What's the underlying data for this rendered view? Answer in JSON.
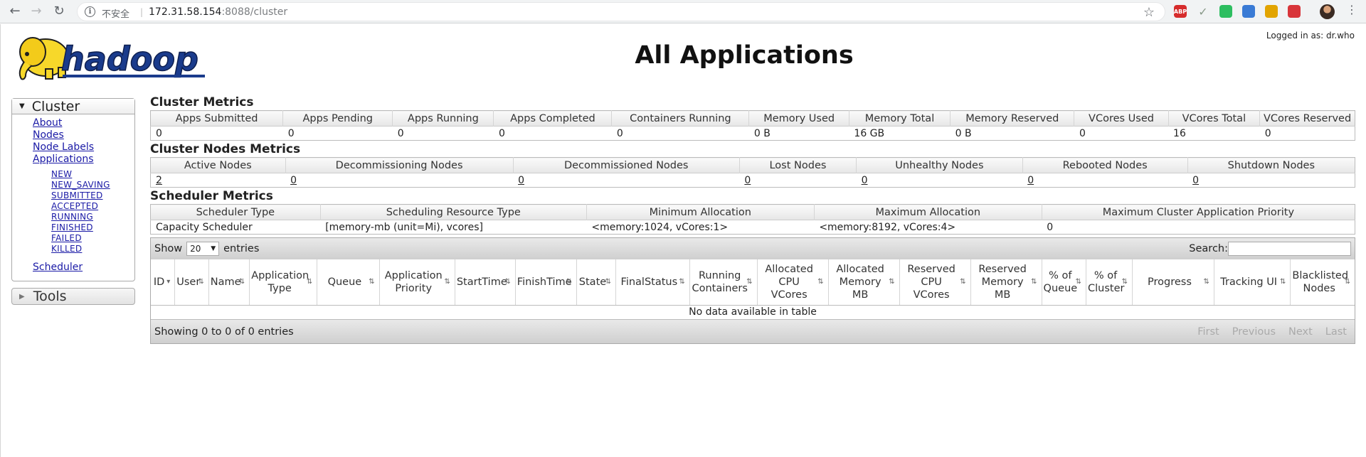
{
  "browser": {
    "security_label": "不安全",
    "url_host": "172.31.58.154",
    "url_rest": ":8088/cluster",
    "extensions": [
      {
        "name": "adblock-icon",
        "text": "ABP",
        "color": "#d62c2c"
      },
      {
        "name": "checkmark-ext-icon",
        "text": "✓",
        "color": "#8a9a8a"
      },
      {
        "name": "evernote-icon",
        "text": "",
        "color": "#2dbe60"
      },
      {
        "name": "shield-ext-icon",
        "text": "",
        "color": "#3a7bd5"
      },
      {
        "name": "lion-ext-icon",
        "text": "",
        "color": "#e2a400"
      },
      {
        "name": "red-ext-icon",
        "text": "",
        "color": "#d8353a"
      }
    ]
  },
  "header": {
    "logo_text": "hadoop",
    "title": "All Applications",
    "logged_in": "Logged in as: dr.who"
  },
  "sidebar": {
    "cluster_label": "Cluster",
    "links": [
      "About",
      "Nodes",
      "Node Labels",
      "Applications"
    ],
    "app_states": [
      "NEW",
      "NEW_SAVING",
      "SUBMITTED",
      "ACCEPTED",
      "RUNNING",
      "FINISHED",
      "FAILED",
      "KILLED"
    ],
    "scheduler_link": "Scheduler",
    "tools_label": "Tools"
  },
  "cluster_metrics": {
    "title": "Cluster Metrics",
    "headers": [
      "Apps Submitted",
      "Apps Pending",
      "Apps Running",
      "Apps Completed",
      "Containers Running",
      "Memory Used",
      "Memory Total",
      "Memory Reserved",
      "VCores Used",
      "VCores Total",
      "VCores Reserved"
    ],
    "values": [
      "0",
      "0",
      "0",
      "0",
      "0",
      "0 B",
      "16 GB",
      "0 B",
      "0",
      "16",
      "0"
    ]
  },
  "nodes_metrics": {
    "title": "Cluster Nodes Metrics",
    "headers": [
      "Active Nodes",
      "Decommissioning Nodes",
      "Decommissioned Nodes",
      "Lost Nodes",
      "Unhealthy Nodes",
      "Rebooted Nodes",
      "Shutdown Nodes"
    ],
    "values": [
      "2",
      "0",
      "0",
      "0",
      "0",
      "0",
      "0"
    ]
  },
  "scheduler_metrics": {
    "title": "Scheduler Metrics",
    "headers": [
      "Scheduler Type",
      "Scheduling Resource Type",
      "Minimum Allocation",
      "Maximum Allocation",
      "Maximum Cluster Application Priority"
    ],
    "values": [
      "Capacity Scheduler",
      "[memory-mb (unit=Mi), vcores]",
      "<memory:1024, vCores:1>",
      "<memory:8192, vCores:4>",
      "0"
    ]
  },
  "apps_table": {
    "show_label": "Show",
    "page_size": "20",
    "entries_label": "entries",
    "search_label": "Search:",
    "columns": [
      "ID",
      "User",
      "Name",
      "Application Type",
      "Queue",
      "Application Priority",
      "StartTime",
      "FinishTime",
      "State",
      "FinalStatus",
      "Running Containers",
      "Allocated CPU VCores",
      "Allocated Memory MB",
      "Reserved CPU VCores",
      "Reserved Memory MB",
      "% of Queue",
      "% of Cluster",
      "Progress",
      "Tracking UI",
      "Blacklisted Nodes"
    ],
    "empty_message": "No data available in table",
    "info": "Showing 0 to 0 of 0 entries",
    "pager": [
      "First",
      "Previous",
      "Next",
      "Last"
    ]
  }
}
